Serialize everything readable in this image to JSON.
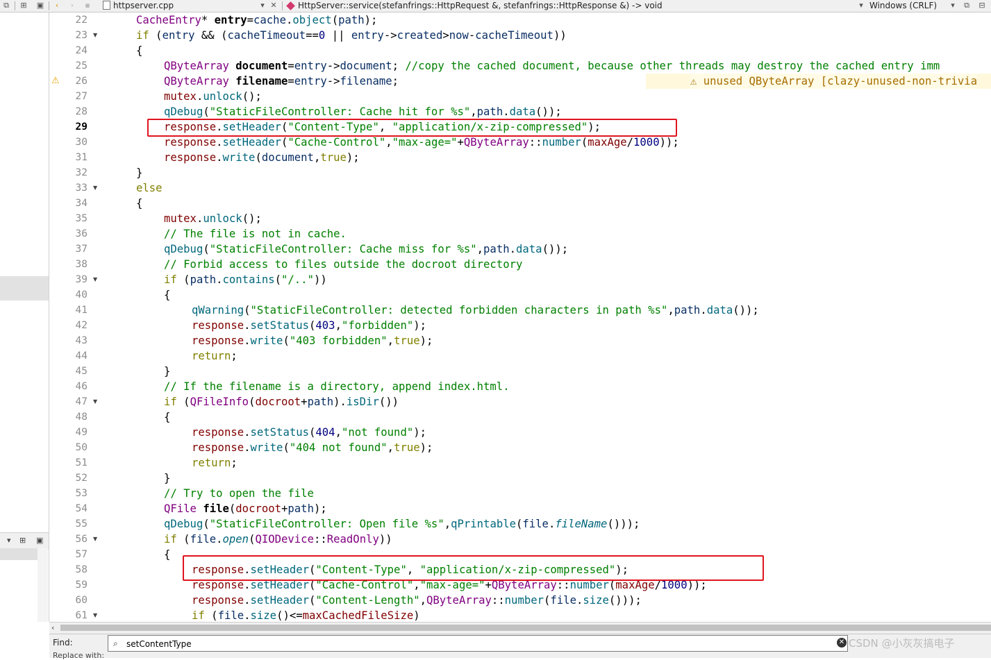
{
  "toolbar": {
    "file_name": "httpserver.cpp",
    "function_signature": "HttpServer::service(stefanfrings::HttpRequest &, stefanfrings::HttpResponse &) -> void",
    "line_ending": "Windows (CRLF)"
  },
  "editor": {
    "current_line": 29,
    "warning_annotation": "unused QByteArray [clazy-unused-non-trivia",
    "lines": [
      {
        "n": "22",
        "fold": false
      },
      {
        "n": "23",
        "fold": true
      },
      {
        "n": "24",
        "fold": false
      },
      {
        "n": "25",
        "fold": false
      },
      {
        "n": "26",
        "fold": false,
        "warn": true
      },
      {
        "n": "27",
        "fold": false
      },
      {
        "n": "28",
        "fold": false
      },
      {
        "n": "29",
        "fold": false
      },
      {
        "n": "30",
        "fold": false
      },
      {
        "n": "31",
        "fold": false
      },
      {
        "n": "32",
        "fold": false
      },
      {
        "n": "33",
        "fold": true
      },
      {
        "n": "34",
        "fold": false
      },
      {
        "n": "35",
        "fold": false
      },
      {
        "n": "36",
        "fold": false
      },
      {
        "n": "37",
        "fold": false
      },
      {
        "n": "38",
        "fold": false
      },
      {
        "n": "39",
        "fold": true
      },
      {
        "n": "40",
        "fold": false
      },
      {
        "n": "41",
        "fold": false
      },
      {
        "n": "42",
        "fold": false
      },
      {
        "n": "43",
        "fold": false
      },
      {
        "n": "44",
        "fold": false
      },
      {
        "n": "45",
        "fold": false
      },
      {
        "n": "46",
        "fold": false
      },
      {
        "n": "47",
        "fold": true
      },
      {
        "n": "48",
        "fold": false
      },
      {
        "n": "49",
        "fold": false
      },
      {
        "n": "50",
        "fold": false
      },
      {
        "n": "51",
        "fold": false
      },
      {
        "n": "52",
        "fold": false
      },
      {
        "n": "53",
        "fold": false
      },
      {
        "n": "54",
        "fold": false
      },
      {
        "n": "55",
        "fold": false
      },
      {
        "n": "56",
        "fold": true
      },
      {
        "n": "57",
        "fold": false
      },
      {
        "n": "58",
        "fold": false
      },
      {
        "n": "59",
        "fold": false
      },
      {
        "n": "60",
        "fold": false
      },
      {
        "n": "61",
        "fold": true
      }
    ],
    "code": [
      [
        [
          "t",
          "CacheEntry"
        ],
        [
          "o",
          "* "
        ],
        [
          "b",
          "entry"
        ],
        [
          "o",
          "="
        ],
        [
          "p",
          "cache"
        ],
        [
          "o",
          "."
        ],
        [
          "f",
          "object"
        ],
        [
          "o",
          "("
        ],
        [
          "p",
          "path"
        ],
        [
          "o",
          ");"
        ]
      ],
      [
        [
          "k",
          "if"
        ],
        [
          "o",
          " ("
        ],
        [
          "p",
          "entry"
        ],
        [
          "o",
          " && ("
        ],
        [
          "p",
          "cacheTimeout"
        ],
        [
          "o",
          "=="
        ],
        [
          "n",
          "0"
        ],
        [
          "o",
          " || "
        ],
        [
          "p",
          "entry"
        ],
        [
          "o",
          "->"
        ],
        [
          "p",
          "created"
        ],
        [
          "o",
          ">"
        ],
        [
          "p",
          "now"
        ],
        [
          "o",
          "-"
        ],
        [
          "p",
          "cacheTimeout"
        ],
        [
          "o",
          "))"
        ]
      ],
      [
        [
          "o",
          "{"
        ]
      ],
      [
        [
          "t",
          "QByteArray"
        ],
        [
          "o",
          " "
        ],
        [
          "b",
          "document"
        ],
        [
          "o",
          "="
        ],
        [
          "p",
          "entry"
        ],
        [
          "o",
          "->"
        ],
        [
          "p",
          "document"
        ],
        [
          "o",
          "; "
        ],
        [
          "c",
          "//copy the cached document, because other threads may destroy the cached entry imm"
        ]
      ],
      [
        [
          "t",
          "QByteArray"
        ],
        [
          "o",
          " "
        ],
        [
          "b",
          "filename"
        ],
        [
          "o",
          "="
        ],
        [
          "p",
          "entry"
        ],
        [
          "o",
          "->"
        ],
        [
          "p",
          "filename"
        ],
        [
          "o",
          ";"
        ]
      ],
      [
        [
          "m",
          "mutex"
        ],
        [
          "o",
          "."
        ],
        [
          "f",
          "unlock"
        ],
        [
          "o",
          "();"
        ]
      ],
      [
        [
          "f",
          "qDebug"
        ],
        [
          "o",
          "("
        ],
        [
          "s",
          "\"StaticFileController: Cache hit for %s\""
        ],
        [
          "o",
          ","
        ],
        [
          "p",
          "path"
        ],
        [
          "o",
          "."
        ],
        [
          "f",
          "data"
        ],
        [
          "o",
          "());"
        ]
      ],
      [
        [
          "m",
          "response"
        ],
        [
          "o",
          "."
        ],
        [
          "f",
          "setHeader"
        ],
        [
          "o",
          "("
        ],
        [
          "s",
          "\"Content-Type\""
        ],
        [
          "o",
          ", "
        ],
        [
          "s",
          "\"application/x-zip-compressed\""
        ],
        [
          "o",
          ");"
        ]
      ],
      [
        [
          "m",
          "response"
        ],
        [
          "o",
          "."
        ],
        [
          "f",
          "setHeader"
        ],
        [
          "o",
          "("
        ],
        [
          "s",
          "\"Cache-Control\""
        ],
        [
          "o",
          ","
        ],
        [
          "s",
          "\"max-age=\""
        ],
        [
          "o",
          "+"
        ],
        [
          "t",
          "QByteArray"
        ],
        [
          "o",
          "::"
        ],
        [
          "f",
          "number"
        ],
        [
          "o",
          "("
        ],
        [
          "m",
          "maxAge"
        ],
        [
          "o",
          "/"
        ],
        [
          "n",
          "1000"
        ],
        [
          "o",
          "));"
        ]
      ],
      [
        [
          "m",
          "response"
        ],
        [
          "o",
          "."
        ],
        [
          "f",
          "write"
        ],
        [
          "o",
          "("
        ],
        [
          "p",
          "document"
        ],
        [
          "o",
          ","
        ],
        [
          "k",
          "true"
        ],
        [
          "o",
          ");"
        ]
      ],
      [
        [
          "o",
          "}"
        ]
      ],
      [
        [
          "k",
          "else"
        ]
      ],
      [
        [
          "o",
          "{"
        ]
      ],
      [
        [
          "m",
          "mutex"
        ],
        [
          "o",
          "."
        ],
        [
          "f",
          "unlock"
        ],
        [
          "o",
          "();"
        ]
      ],
      [
        [
          "c",
          "// The file is not in cache."
        ]
      ],
      [
        [
          "f",
          "qDebug"
        ],
        [
          "o",
          "("
        ],
        [
          "s",
          "\"StaticFileController: Cache miss for %s\""
        ],
        [
          "o",
          ","
        ],
        [
          "p",
          "path"
        ],
        [
          "o",
          "."
        ],
        [
          "f",
          "data"
        ],
        [
          "o",
          "());"
        ]
      ],
      [
        [
          "c",
          "// Forbid access to files outside the docroot directory"
        ]
      ],
      [
        [
          "k",
          "if"
        ],
        [
          "o",
          " ("
        ],
        [
          "p",
          "path"
        ],
        [
          "o",
          "."
        ],
        [
          "f",
          "contains"
        ],
        [
          "o",
          "("
        ],
        [
          "s",
          "\"/..\""
        ],
        [
          "o",
          "))"
        ]
      ],
      [
        [
          "o",
          "{"
        ]
      ],
      [
        [
          "f",
          "qWarning"
        ],
        [
          "o",
          "("
        ],
        [
          "s",
          "\"StaticFileController: detected forbidden characters in path %s\""
        ],
        [
          "o",
          ","
        ],
        [
          "p",
          "path"
        ],
        [
          "o",
          "."
        ],
        [
          "f",
          "data"
        ],
        [
          "o",
          "());"
        ]
      ],
      [
        [
          "m",
          "response"
        ],
        [
          "o",
          "."
        ],
        [
          "f",
          "setStatus"
        ],
        [
          "o",
          "("
        ],
        [
          "n",
          "403"
        ],
        [
          "o",
          ","
        ],
        [
          "s",
          "\"forbidden\""
        ],
        [
          "o",
          ");"
        ]
      ],
      [
        [
          "m",
          "response"
        ],
        [
          "o",
          "."
        ],
        [
          "f",
          "write"
        ],
        [
          "o",
          "("
        ],
        [
          "s",
          "\"403 forbidden\""
        ],
        [
          "o",
          ","
        ],
        [
          "k",
          "true"
        ],
        [
          "o",
          ");"
        ]
      ],
      [
        [
          "k",
          "return"
        ],
        [
          "o",
          ";"
        ]
      ],
      [
        [
          "o",
          "}"
        ]
      ],
      [
        [
          "c",
          "// If the filename is a directory, append index.html."
        ]
      ],
      [
        [
          "k",
          "if"
        ],
        [
          "o",
          " ("
        ],
        [
          "t",
          "QFileInfo"
        ],
        [
          "o",
          "("
        ],
        [
          "m",
          "docroot"
        ],
        [
          "o",
          "+"
        ],
        [
          "p",
          "path"
        ],
        [
          "o",
          ")."
        ],
        [
          "f",
          "isDir"
        ],
        [
          "o",
          "())"
        ]
      ],
      [
        [
          "o",
          "{"
        ]
      ],
      [
        [
          "m",
          "response"
        ],
        [
          "o",
          "."
        ],
        [
          "f",
          "setStatus"
        ],
        [
          "o",
          "("
        ],
        [
          "n",
          "404"
        ],
        [
          "o",
          ","
        ],
        [
          "s",
          "\"not found\""
        ],
        [
          "o",
          ");"
        ]
      ],
      [
        [
          "m",
          "response"
        ],
        [
          "o",
          "."
        ],
        [
          "f",
          "write"
        ],
        [
          "o",
          "("
        ],
        [
          "s",
          "\"404 not found\""
        ],
        [
          "o",
          ","
        ],
        [
          "k",
          "true"
        ],
        [
          "o",
          ");"
        ]
      ],
      [
        [
          "k",
          "return"
        ],
        [
          "o",
          ";"
        ]
      ],
      [
        [
          "o",
          "}"
        ]
      ],
      [
        [
          "c",
          "// Try to open the file"
        ]
      ],
      [
        [
          "t",
          "QFile"
        ],
        [
          "o",
          " "
        ],
        [
          "b",
          "file"
        ],
        [
          "o",
          "("
        ],
        [
          "m",
          "docroot"
        ],
        [
          "o",
          "+"
        ],
        [
          "p",
          "path"
        ],
        [
          "o",
          ");"
        ]
      ],
      [
        [
          "f",
          "qDebug"
        ],
        [
          "o",
          "("
        ],
        [
          "s",
          "\"StaticFileController: Open file %s\""
        ],
        [
          "o",
          ","
        ],
        [
          "f",
          "qPrintable"
        ],
        [
          "o",
          "("
        ],
        [
          "p",
          "file"
        ],
        [
          "o",
          "."
        ],
        [
          "i",
          "fileName"
        ],
        [
          "o",
          "()));"
        ]
      ],
      [
        [
          "k",
          "if"
        ],
        [
          "o",
          " ("
        ],
        [
          "p",
          "file"
        ],
        [
          "o",
          "."
        ],
        [
          "i",
          "open"
        ],
        [
          "o",
          "("
        ],
        [
          "t",
          "QIODevice"
        ],
        [
          "o",
          "::"
        ],
        [
          "t",
          "ReadOnly"
        ],
        [
          "o",
          "))"
        ]
      ],
      [
        [
          "o",
          "{"
        ]
      ],
      [
        [
          "m",
          "response"
        ],
        [
          "o",
          "."
        ],
        [
          "f",
          "setHeader"
        ],
        [
          "o",
          "("
        ],
        [
          "s",
          "\"Content-Type\""
        ],
        [
          "o",
          ", "
        ],
        [
          "s",
          "\"application/x-zip-compressed\""
        ],
        [
          "o",
          ");"
        ]
      ],
      [
        [
          "m",
          "response"
        ],
        [
          "o",
          "."
        ],
        [
          "f",
          "setHeader"
        ],
        [
          "o",
          "("
        ],
        [
          "s",
          "\"Cache-Control\""
        ],
        [
          "o",
          ","
        ],
        [
          "s",
          "\"max-age=\""
        ],
        [
          "o",
          "+"
        ],
        [
          "t",
          "QByteArray"
        ],
        [
          "o",
          "::"
        ],
        [
          "f",
          "number"
        ],
        [
          "o",
          "("
        ],
        [
          "m",
          "maxAge"
        ],
        [
          "o",
          "/"
        ],
        [
          "n",
          "1000"
        ],
        [
          "o",
          "));"
        ]
      ],
      [
        [
          "m",
          "response"
        ],
        [
          "o",
          "."
        ],
        [
          "f",
          "setHeader"
        ],
        [
          "o",
          "("
        ],
        [
          "s",
          "\"Content-Length\""
        ],
        [
          "o",
          ","
        ],
        [
          "t",
          "QByteArray"
        ],
        [
          "o",
          "::"
        ],
        [
          "f",
          "number"
        ],
        [
          "o",
          "("
        ],
        [
          "p",
          "file"
        ],
        [
          "o",
          "."
        ],
        [
          "f",
          "size"
        ],
        [
          "o",
          "()));"
        ]
      ],
      [
        [
          "k",
          "if"
        ],
        [
          "o",
          " ("
        ],
        [
          "p",
          "file"
        ],
        [
          "o",
          "."
        ],
        [
          "f",
          "size"
        ],
        [
          "o",
          "()<="
        ],
        [
          "m",
          "maxCachedFileSize"
        ],
        [
          "o",
          ")"
        ]
      ]
    ]
  },
  "find": {
    "label": "Find:",
    "value": "setContentType",
    "extra": "CSDN @小灰灰搞电子 Sele",
    "sub_label": "Replace with:"
  },
  "watermark": "CSDN @小灰灰搞电子"
}
